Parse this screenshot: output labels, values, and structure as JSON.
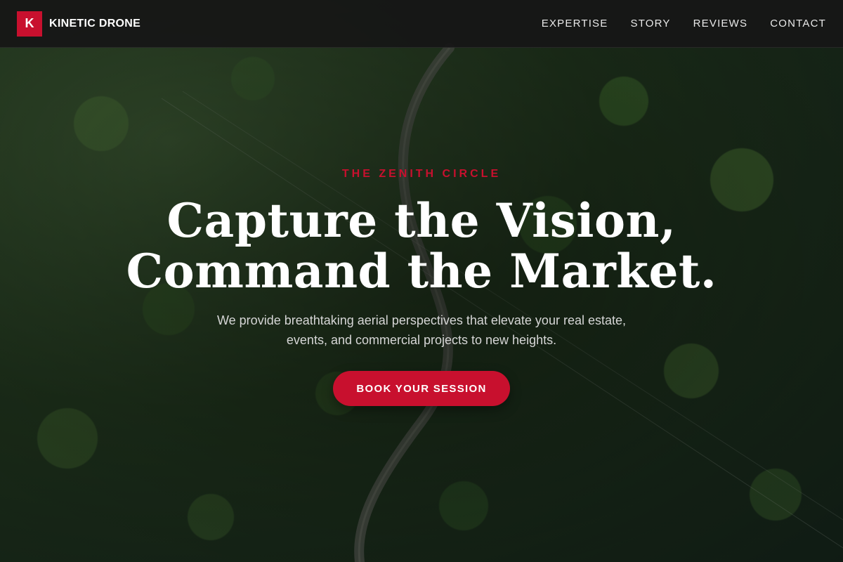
{
  "brand": {
    "mark": "K",
    "name": "KINETIC DRONE"
  },
  "nav": {
    "items": [
      {
        "label": "EXPERTISE"
      },
      {
        "label": "STORY"
      },
      {
        "label": "REVIEWS"
      },
      {
        "label": "CONTACT"
      }
    ]
  },
  "hero": {
    "eyebrow": "THE ZENITH CIRCLE",
    "headline_line1": "Capture the Vision,",
    "headline_line2": "Command the Market.",
    "subtext": "We provide breathtaking aerial perspectives that elevate your real estate, events, and commercial projects to new heights.",
    "cta_label": "BOOK YOUR SESSION"
  },
  "colors": {
    "accent": "#c8102e",
    "nav_bg": "#161616",
    "text_primary": "#ffffff",
    "text_muted": "#d6d6d6"
  }
}
